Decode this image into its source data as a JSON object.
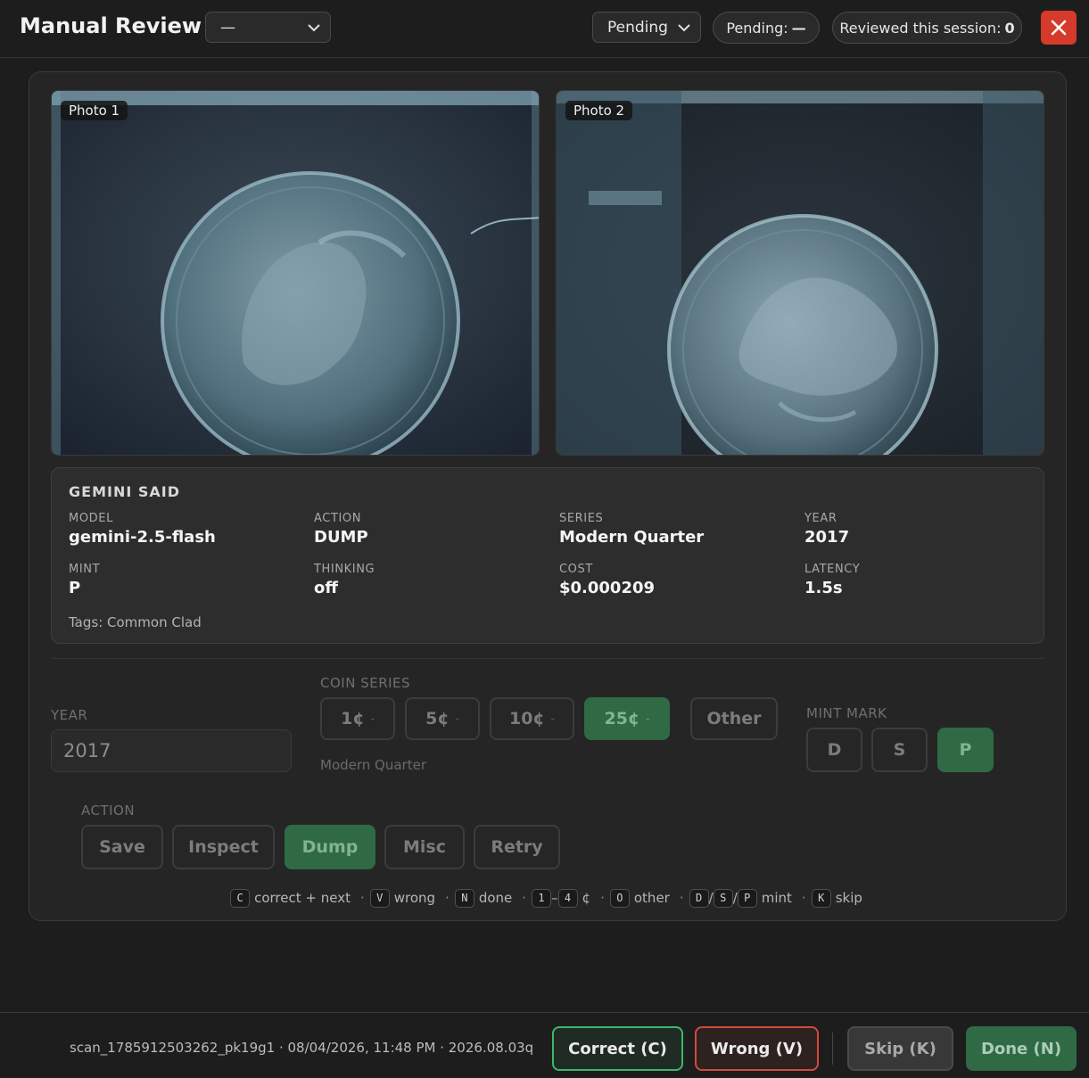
{
  "header": {
    "title": "Manual Review",
    "session_select": "—",
    "status_select": "Pending",
    "pending_label": "Pending:",
    "pending_value": "—",
    "reviewed_label": "Reviewed this session:",
    "reviewed_value": "0"
  },
  "photos": [
    {
      "label": "Photo 1"
    },
    {
      "label": "Photo 2"
    }
  ],
  "gemini": {
    "heading": "GEMINI SAID",
    "fields": {
      "model": {
        "label": "MODEL",
        "value": "gemini-2.5-flash"
      },
      "action": {
        "label": "ACTION",
        "value": "DUMP"
      },
      "series": {
        "label": "SERIES",
        "value": "Modern Quarter"
      },
      "year": {
        "label": "YEAR",
        "value": "2017"
      },
      "mint": {
        "label": "MINT",
        "value": "P"
      },
      "thinking": {
        "label": "THINKING",
        "value": "off"
      },
      "cost": {
        "label": "COST",
        "value": "$0.000209"
      },
      "latency": {
        "label": "LATENCY",
        "value": "1.5s"
      }
    },
    "tags": "Tags: Common Clad"
  },
  "form": {
    "year_label": "YEAR",
    "year_value": "2017",
    "series_label": "COIN SERIES",
    "series_buttons": [
      {
        "label": "1¢",
        "caret": "-"
      },
      {
        "label": "5¢",
        "caret": "-"
      },
      {
        "label": "10¢",
        "caret": "-"
      },
      {
        "label": "25¢",
        "caret": "-"
      },
      {
        "label": "Other"
      }
    ],
    "selected_series": "25¢",
    "series_name": "Modern Quarter",
    "mint_label": "MINT MARK",
    "mint_buttons": [
      "D",
      "S",
      "P"
    ],
    "selected_mint": "P",
    "action_label": "ACTION",
    "action_buttons": [
      "Save",
      "Inspect",
      "Dump",
      "Misc",
      "Retry"
    ],
    "selected_action": "Dump"
  },
  "shortcuts": {
    "c_key": "C",
    "c_text": "correct + next",
    "v_key": "V",
    "v_text": "wrong",
    "n_key": "N",
    "n_text": "done",
    "range_start": "1",
    "range_dash": "–",
    "range_end": "4",
    "cent": "¢",
    "o_key": "O",
    "o_text": "other",
    "d_key": "D",
    "s_key": "S",
    "p_key": "P",
    "slash": "/",
    "mint_text": "mint",
    "k_key": "K",
    "k_text": "skip",
    "sep": "·"
  },
  "footer": {
    "meta": "scan_1785912503262_pk19g1 · 08/04/2026, 11:48 PM · 2026.08.03q",
    "correct": "Correct (C)",
    "wrong": "Wrong (V)",
    "skip": "Skip (K)",
    "done": "Done (N)"
  },
  "colors": {
    "accent_green": "#2f6a45",
    "close_red": "#d53a2b",
    "correct_border": "#3bb86a",
    "wrong_border": "#d24a3a"
  }
}
